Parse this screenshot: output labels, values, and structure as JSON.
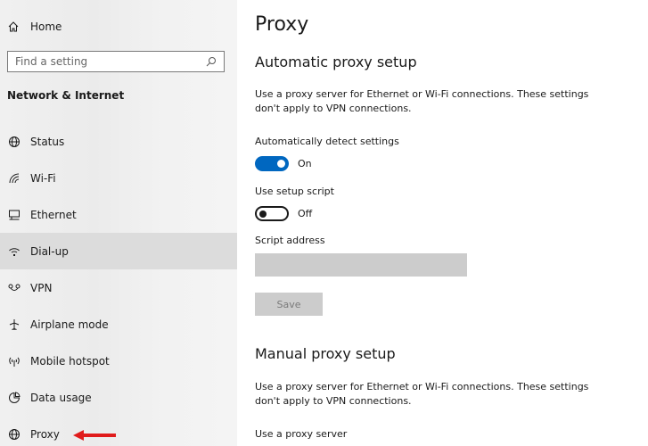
{
  "sidebar": {
    "home_label": "Home",
    "search_placeholder": "Find a setting",
    "section_label": "Network & Internet",
    "items": [
      {
        "label": "Status",
        "icon": "globe-status-icon"
      },
      {
        "label": "Wi-Fi",
        "icon": "wifi-icon"
      },
      {
        "label": "Ethernet",
        "icon": "ethernet-icon"
      },
      {
        "label": "Dial-up",
        "icon": "dialup-icon"
      },
      {
        "label": "VPN",
        "icon": "vpn-icon"
      },
      {
        "label": "Airplane mode",
        "icon": "airplane-icon"
      },
      {
        "label": "Mobile hotspot",
        "icon": "hotspot-icon"
      },
      {
        "label": "Data usage",
        "icon": "data-usage-icon"
      },
      {
        "label": "Proxy",
        "icon": "globe-icon"
      }
    ],
    "active_item": "Dial-up",
    "annotation_arrow_color": "#e01b1b"
  },
  "main": {
    "title": "Proxy",
    "auto": {
      "heading": "Automatic proxy setup",
      "description": "Use a proxy server for Ethernet or Wi-Fi connections. These settings don't apply to VPN connections.",
      "detect_label": "Automatically detect settings",
      "detect_state": "On",
      "script_label": "Use setup script",
      "script_state": "Off",
      "address_label": "Script address",
      "address_value": "",
      "save_label": "Save"
    },
    "manual": {
      "heading": "Manual proxy setup",
      "description": "Use a proxy server for Ethernet or Wi-Fi connections. These settings don't apply to VPN connections.",
      "use_proxy_label": "Use a proxy server"
    }
  },
  "colors": {
    "accent": "#0067c0",
    "disabled": "#cccccc"
  }
}
